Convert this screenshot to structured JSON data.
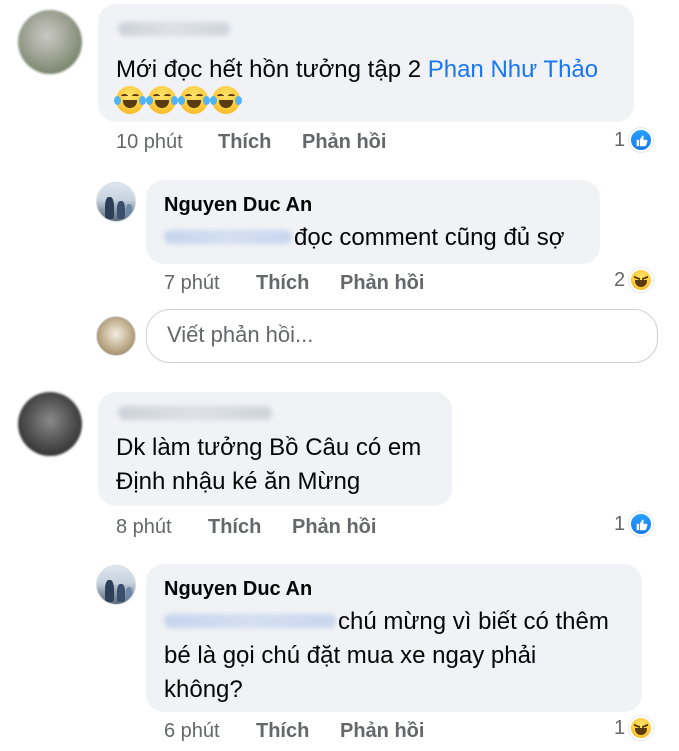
{
  "thread": [
    {
      "comment_text": "Mới đọc hết hồn tưởng tập 2 ",
      "mention": "Phan Như Thảo",
      "emoji_icon": "laughing-tears-emoji",
      "time": "10 phút",
      "like_label": "Thích",
      "reply_label": "Phản hồi",
      "reaction_count": "1",
      "reaction_icon": "like-icon"
    },
    {
      "author": "Nguyen Duc An",
      "comment_text": "đọc comment cũng đủ sợ",
      "time": "7 phút",
      "like_label": "Thích",
      "reply_label": "Phản hồi",
      "reaction_count": "2",
      "reaction_icon": "haha-icon"
    },
    {
      "comment_line1": "Dk làm tưởng Bồ  Câu có em",
      "comment_line2": "Định nhậu ké ăn Mừng",
      "time": "8 phút",
      "like_label": "Thích",
      "reply_label": "Phản hồi",
      "reaction_count": "1",
      "reaction_icon": "like-icon"
    },
    {
      "author": "Nguyen Duc An",
      "comment_line1": "chú mừng vì biết có thêm",
      "comment_line2": "bé là gọi chú đặt mua xe ngay phải",
      "comment_line3": "không?",
      "time": "6 phút",
      "like_label": "Thích",
      "reply_label": "Phản hồi",
      "reaction_count": "1",
      "reaction_icon": "haha-icon"
    }
  ],
  "reply_box": {
    "placeholder": "Viết phản hồi..."
  },
  "colors": {
    "bubble_bg": "#f0f2f5",
    "text": "#050505",
    "meta": "#65676b",
    "mention": "#1877f2",
    "like_blue": "#1877f2",
    "haha_yellow": "#fcc93a"
  }
}
